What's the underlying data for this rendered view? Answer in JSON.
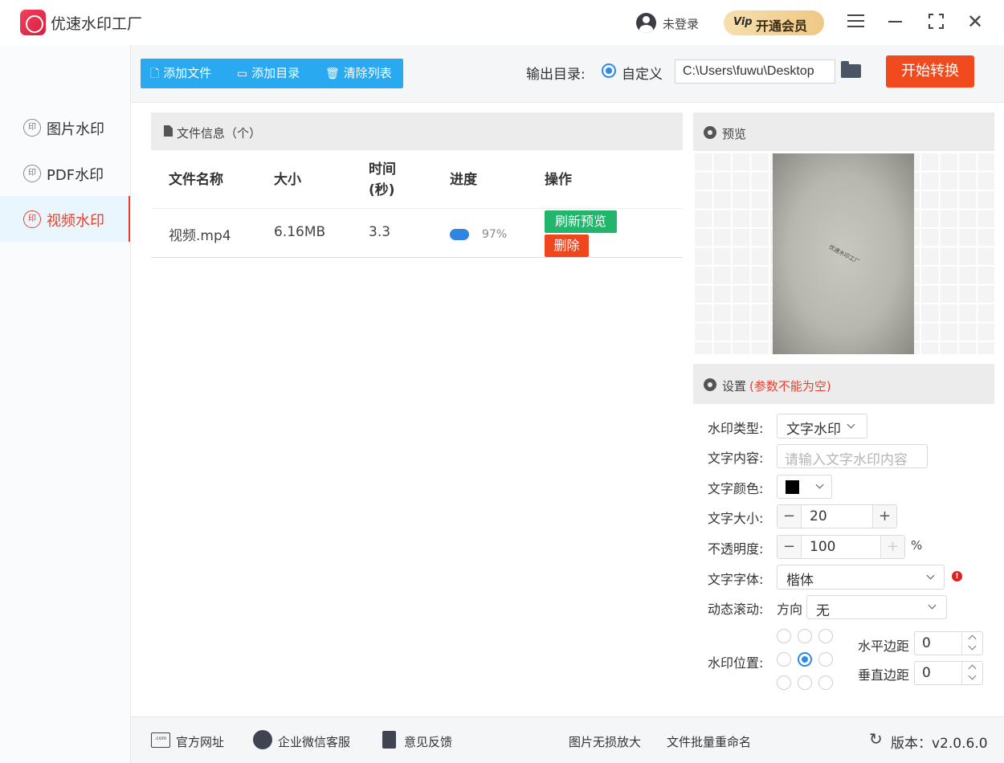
{
  "app": {
    "title": "优速水印工厂"
  },
  "header": {
    "login_label": "未登录",
    "vip_label": "开通会员",
    "vip_icon": "Vip"
  },
  "sidebar": {
    "items": [
      {
        "label": "图片水印",
        "icon_text": "印",
        "active": false
      },
      {
        "label": "PDF水印",
        "icon_text": "印",
        "active": false
      },
      {
        "label": "视频水印",
        "icon_text": "印",
        "active": true
      }
    ]
  },
  "toolbar": {
    "add_file": "添加文件",
    "add_dir": "添加目录",
    "clear_list": "清除列表",
    "output_label": "输出目录:",
    "radio_label": "自定义",
    "output_path": "C:\\Users\\fuwu\\Desktop",
    "start_label": "开始转换"
  },
  "file_panel": {
    "title": "文件信息（个）",
    "columns": {
      "name": "文件名称",
      "size": "大小",
      "time_1": "时间",
      "time_2": "(秒)",
      "progress": "进度",
      "action": "操作"
    },
    "rows": [
      {
        "name": "视频.mp4",
        "size": "6.16MB",
        "time": "3.3",
        "progress": 0.97,
        "progress_label": "97%",
        "refresh_label": "刷新预览",
        "delete_label": "删除"
      }
    ]
  },
  "preview": {
    "title": "预览",
    "watermark_text": "优速水印工厂"
  },
  "settings": {
    "title": "设置",
    "note": "(参数不能为空)",
    "type_label": "水印类型:",
    "type_value": "文字水印",
    "content_label": "文字内容:",
    "content_placeholder": "请输入文字水印内容",
    "color_label": "文字颜色:",
    "color_value": "#000000",
    "size_label": "文字大小:",
    "size_value": "20",
    "opacity_label": "不透明度:",
    "opacity_value": "100",
    "opacity_unit": "%",
    "font_label": "文字字体:",
    "font_value": "楷体",
    "scroll_label": "动态滚动:",
    "direction_label": "方向",
    "direction_value": "无",
    "position_label": "水印位置:",
    "position_selected": "center",
    "h_margin_label": "水平边距",
    "h_margin_value": "0",
    "v_margin_label": "垂直边距",
    "v_margin_value": "0"
  },
  "footer": {
    "website": "官方网址",
    "wechat": "企业微信客服",
    "feedback": "意见反馈",
    "upscale": "图片无损放大",
    "rename": "文件批量重命名",
    "version": "版本：v2.0.6.0"
  },
  "colors": {
    "accent": "#29aaf0",
    "start": "#f04a1e",
    "active_red": "#e7402e",
    "green": "#21b66c",
    "progress": "#2e86de"
  }
}
